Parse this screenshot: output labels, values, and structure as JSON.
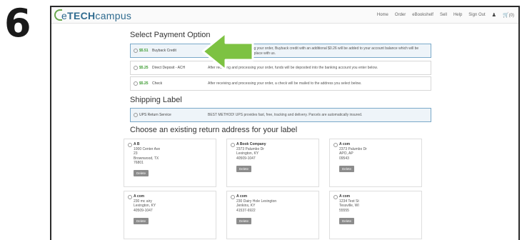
{
  "step_number": "6",
  "brand": {
    "logo_text_1": "e",
    "logo_text_2": "TECH",
    "logo_text_3": "campus"
  },
  "nav": {
    "items": [
      "Home",
      "Order",
      "eBookshelf",
      "Sell",
      "Help",
      "Sign Out"
    ],
    "cart_count": "(0)"
  },
  "payment": {
    "title": "Select Payment Option",
    "options": [
      {
        "amount": "$5.51",
        "label": "Buyback Credit",
        "desc": "After receiving and processing your order, Buyback credit with an additional $0.26 will be added to your account balance which will be applied to the next order you place with us."
      },
      {
        "amount": "$5.25",
        "label": "Direct Deposit - ACH",
        "desc": "After receiving and processing your order, funds will be deposited into the banking account you enter below."
      },
      {
        "amount": "$5.25",
        "label": "Check",
        "desc": "After receiving and processing your order, a check will be mailed to the address you select below."
      }
    ]
  },
  "shipping": {
    "title": "Shipping Label",
    "option_label": "UPS Return Service",
    "option_desc": "BEST METHOD! UPS provides fast, free, tracking and delivery. Parcels are automatically insured."
  },
  "address": {
    "title": "Choose an existing return address for your label",
    "delete_label": "Delete",
    "cards": [
      {
        "l1": "A B",
        "l2": "1000 Center Ave",
        "l3": "23",
        "l4": "Brownwood, TX",
        "l5": "76801"
      },
      {
        "l1": "A Book Company",
        "l2": "2373 Palumbo Dr",
        "l3": "Lexington, KY",
        "l4": "40509-1047",
        "l5": ""
      },
      {
        "l1": "A com",
        "l2": "2373 Palumbo Dr",
        "l3": "APO, AP",
        "l4": "09543",
        "l5": ""
      },
      {
        "l1": "A com",
        "l2": "230 mc airy",
        "l3": "Lexington, KY",
        "l4": "40509-1047",
        "l5": ""
      },
      {
        "l1": "A com",
        "l2": "230 Dairy Hole Lexington",
        "l3": "Jenkins, KY",
        "l4": "41537-6922",
        "l5": ""
      },
      {
        "l1": "A com",
        "l2": "1234 Test St",
        "l3": "Tessville, WI",
        "l4": "55555",
        "l5": ""
      }
    ]
  },
  "colors": {
    "accent_green": "#3a9a2f",
    "arrow_green": "#7dc242",
    "selected_border": "#7aa9c9"
  }
}
